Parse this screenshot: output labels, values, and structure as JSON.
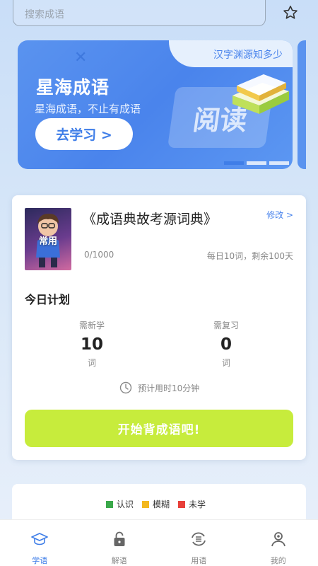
{
  "search": {
    "placeholder": "搜索成语"
  },
  "banner": {
    "tag": "汉字渊源知多少",
    "title": "星海成语",
    "subtitle": "星海成语，不止有成语",
    "button_label": "去学习 >",
    "decor_text": "阅读",
    "pages": 3,
    "active_page": 1
  },
  "book": {
    "cover_label": "常用",
    "title": "《成语典故考源词典》",
    "edit_label": "修改 >",
    "progress": "0/1000",
    "daily_plan": "每日10词，剩余100天"
  },
  "plan": {
    "title": "今日计划",
    "new": {
      "label": "需新学",
      "value": "10",
      "unit": "词"
    },
    "review": {
      "label": "需复习",
      "value": "0",
      "unit": "词"
    },
    "estimate": "预计用时10分钟",
    "start_label": "开始背成语吧!"
  },
  "legend": [
    {
      "label": "认识",
      "color": "#3aa84a"
    },
    {
      "label": "模糊",
      "color": "#f3b81f"
    },
    {
      "label": "未学",
      "color": "#e8403a"
    }
  ],
  "nav": [
    {
      "label": "学语",
      "icon": "graduation-cap-icon",
      "active": true
    },
    {
      "label": "解语",
      "icon": "lock-icon",
      "active": false
    },
    {
      "label": "用语",
      "icon": "swap-icon",
      "active": false
    },
    {
      "label": "我的",
      "icon": "user-icon",
      "active": false
    }
  ],
  "colors": {
    "accent": "#3f7ee8",
    "start_button": "#c7ec3c"
  }
}
